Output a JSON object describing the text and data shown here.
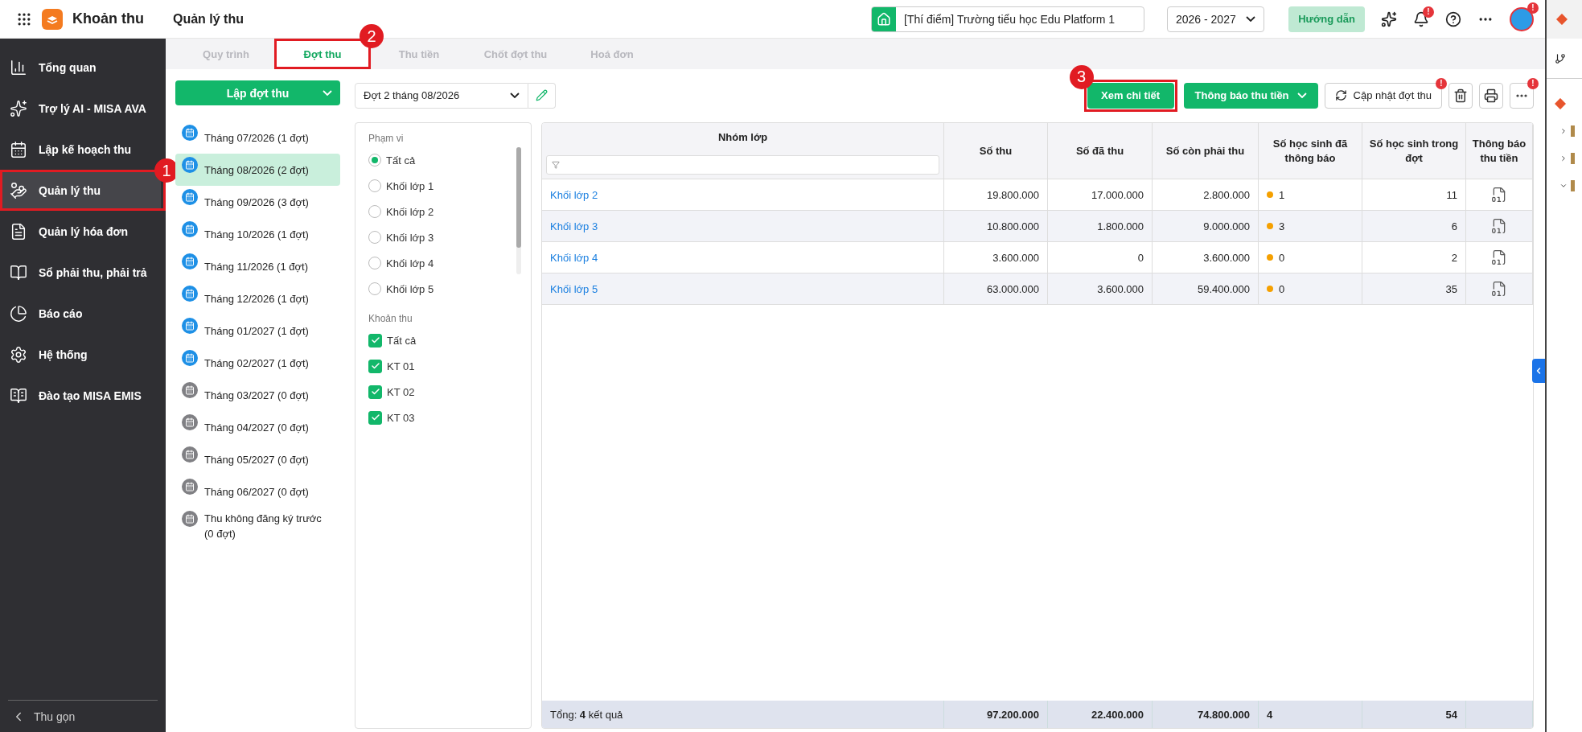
{
  "topbar": {
    "app_name": "Khoản thu",
    "page_title": "Quản lý thu",
    "school": "[Thí điểm] Trường tiểu học Edu Platform 1",
    "year": "2026 - 2027",
    "help_button": "Hướng dẫn",
    "bell_alert": "!",
    "avatar_alert": "!"
  },
  "sidebar": {
    "items": [
      {
        "label": "Tổng quan",
        "kind": "chart",
        "selected": false
      },
      {
        "label": "Trợ lý AI - MISA AVA",
        "kind": "ai",
        "selected": false
      },
      {
        "label": "Lập kế hoạch thu",
        "kind": "plan",
        "selected": false
      },
      {
        "label": "Quản lý thu",
        "kind": "manage",
        "selected": true,
        "callout": "1"
      },
      {
        "label": "Quản lý hóa đơn",
        "kind": "invoice",
        "selected": false
      },
      {
        "label": "Sổ phải thu, phải trả",
        "kind": "ledger",
        "selected": false
      },
      {
        "label": "Báo cáo",
        "kind": "report",
        "selected": false
      },
      {
        "label": "Hệ thống",
        "kind": "settings",
        "selected": false
      },
      {
        "label": "Đào tạo MISA EMIS",
        "kind": "training",
        "selected": false
      }
    ],
    "collapse": "Thu gọn"
  },
  "tabs": [
    {
      "label": "Quy trình",
      "selected": false
    },
    {
      "label": "Đợt thu",
      "selected": true,
      "callout": "2"
    },
    {
      "label": "Thu tiền",
      "selected": false
    },
    {
      "label": "Chốt đợt thu",
      "selected": false
    },
    {
      "label": "Hoá đơn",
      "selected": false
    }
  ],
  "periods": {
    "create_button": "Lập đợt thu",
    "items": [
      {
        "label": "Tháng 07/2026 (1 đợt)",
        "active": true,
        "selected": false
      },
      {
        "label": "Tháng 08/2026 (2 đợt)",
        "active": true,
        "selected": true
      },
      {
        "label": "Tháng 09/2026 (3 đợt)",
        "active": true,
        "selected": false
      },
      {
        "label": "Tháng 10/2026 (1 đợt)",
        "active": true,
        "selected": false
      },
      {
        "label": "Tháng 11/2026 (1 đợt)",
        "active": true,
        "selected": false
      },
      {
        "label": "Tháng 12/2026 (1 đợt)",
        "active": true,
        "selected": false
      },
      {
        "label": "Tháng 01/2027 (1 đợt)",
        "active": true,
        "selected": false
      },
      {
        "label": "Tháng 02/2027 (1 đợt)",
        "active": true,
        "selected": false
      },
      {
        "label": "Tháng 03/2027 (0 đợt)",
        "active": false,
        "selected": false
      },
      {
        "label": "Tháng 04/2027 (0 đợt)",
        "active": false,
        "selected": false
      },
      {
        "label": "Tháng 05/2027 (0 đợt)",
        "active": false,
        "selected": false
      },
      {
        "label": "Tháng 06/2027 (0 đợt)",
        "active": false,
        "selected": false
      },
      {
        "label": "Thu không đăng ký trước (0 đợt)",
        "active": false,
        "selected": false
      }
    ]
  },
  "batch_select": "Đợt 2 tháng 08/2026",
  "filters": {
    "scope_title": "Phạm vi",
    "scope_options": [
      {
        "label": "Tất cả",
        "selected": true
      },
      {
        "label": "Khối lớp 1",
        "selected": false
      },
      {
        "label": "Khối lớp 2",
        "selected": false
      },
      {
        "label": "Khối lớp 3",
        "selected": false
      },
      {
        "label": "Khối lớp 4",
        "selected": false
      },
      {
        "label": "Khối lớp 5",
        "selected": false
      }
    ],
    "fee_title": "Khoản thu",
    "fee_options": [
      {
        "label": "Tất cả",
        "checked": true
      },
      {
        "label": "KT 01",
        "checked": true
      },
      {
        "label": "KT 02",
        "checked": true
      },
      {
        "label": "KT 03",
        "checked": true
      }
    ]
  },
  "actions": {
    "view_button": "Xem chi tiết",
    "view_callout": "3",
    "notify_button": "Thông báo thu tiền",
    "update_button": "Cập nhật đợt thu",
    "update_alert": "!",
    "more_alert": "!"
  },
  "table": {
    "columns": [
      "Nhóm lớp",
      "Số thu",
      "Số đã thu",
      "Số còn phải thu",
      "Số học sinh đã thông báo",
      "Số học sinh trong đợt",
      "Thông báo thu tiền"
    ],
    "rows": [
      {
        "group": "Khối lớp 2",
        "total": "19.800.000",
        "paid": "17.000.000",
        "remaining": "2.800.000",
        "notified": "1",
        "students": "11"
      },
      {
        "group": "Khối lớp 3",
        "total": "10.800.000",
        "paid": "1.800.000",
        "remaining": "9.000.000",
        "notified": "3",
        "students": "6"
      },
      {
        "group": "Khối lớp 4",
        "total": "3.600.000",
        "paid": "0",
        "remaining": "3.600.000",
        "notified": "0",
        "students": "2"
      },
      {
        "group": "Khối lớp 5",
        "total": "63.000.000",
        "paid": "3.600.000",
        "remaining": "59.400.000",
        "notified": "0",
        "students": "35"
      }
    ],
    "footer": {
      "label": "Tổng: **4** kết quả",
      "total": "97.200.000",
      "paid": "22.400.000",
      "remaining": "74.800.000",
      "notified": "4",
      "students": "54"
    }
  }
}
